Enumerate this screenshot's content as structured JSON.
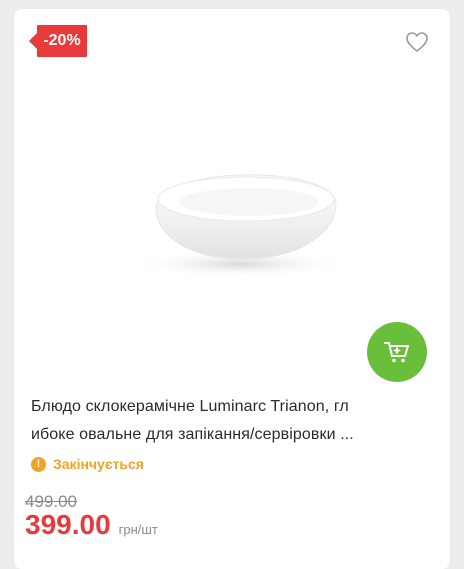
{
  "card": {
    "discount_badge": "-20%",
    "title_lines": [
      "Блюдо склокерамічне Luminarc Trianon, гл",
      "ибоке овальне для запікання/сервіровки ..."
    ],
    "status": "Закінчується",
    "old_price": "499.00",
    "new_price": "399.00",
    "unit": "грн/шт"
  },
  "icons": {
    "favorite": "heart-icon",
    "cart": "cart-icon",
    "status": "warning-icon"
  },
  "colors": {
    "accent_red": "#e83a3a",
    "cart_green": "#6abf3a",
    "status_orange": "#f0a324"
  }
}
